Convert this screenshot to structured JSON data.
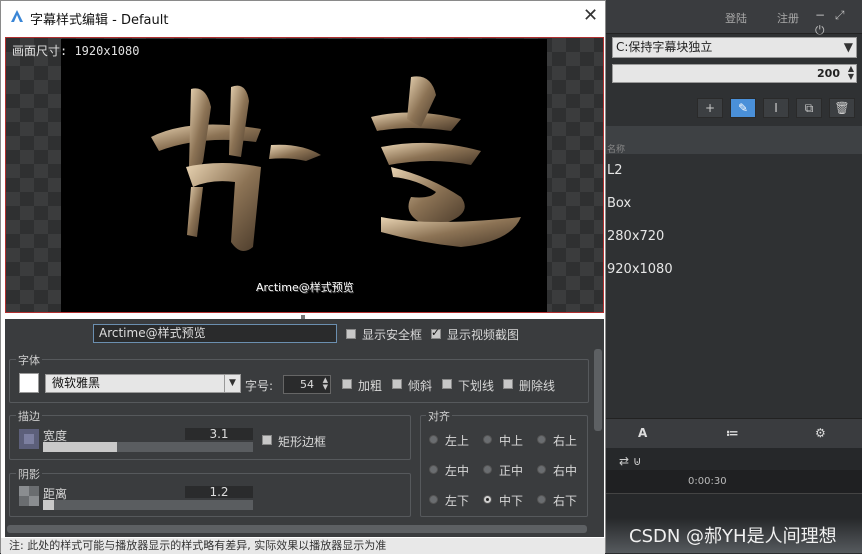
{
  "background_app": {
    "login_label": "登陆",
    "register_label": "注册",
    "window_controls": "− ⤢ ⏻",
    "mode_select": "C:保持字幕块独立",
    "number_value": "200",
    "list_header": "名称",
    "list_items": [
      "L2",
      "Box",
      "280x720",
      "920x1080"
    ],
    "tabs": [
      "A",
      "≔",
      "⚙"
    ],
    "timeline_time": "0:00:30",
    "watermark": "CSDN @郝YH是人间理想"
  },
  "dialog": {
    "title": "字幕样式编辑 - Default",
    "close_label": "✕",
    "preview": {
      "canvas_size_label": "画面尺寸: 1920x1080",
      "sample_overlay_text": "Arctime@样式预览"
    },
    "sample_text_input": "Arctime@样式预览",
    "show_safe_frame_label": "显示安全框",
    "show_safe_frame_checked": false,
    "show_video_capture_label": "显示视频截图",
    "show_video_capture_checked": true,
    "font_group": {
      "title": "字体",
      "font_name": "微软雅黑",
      "size_label": "字号:",
      "size_value": "54",
      "bold_label": "加粗",
      "italic_label": "倾斜",
      "underline_label": "下划线",
      "strike_label": "删除线"
    },
    "stroke_group": {
      "title": "描边",
      "width_label": "宽度",
      "width_value": "3.1",
      "width_level": 0.35,
      "rect_border_label": "矩形边框"
    },
    "shadow_group": {
      "title": "阴影",
      "distance_label": "距离",
      "distance_value": "1.2",
      "distance_level": 0.05
    },
    "align_group": {
      "title": "对齐",
      "options": [
        "左上",
        "中上",
        "右上",
        "左中",
        "正中",
        "右中",
        "左下",
        "中下",
        "右下"
      ],
      "selected": "中下"
    },
    "footnote": "注: 此处的样式可能与播放器显示的样式略有差异, 实际效果以播放器显示为准"
  }
}
